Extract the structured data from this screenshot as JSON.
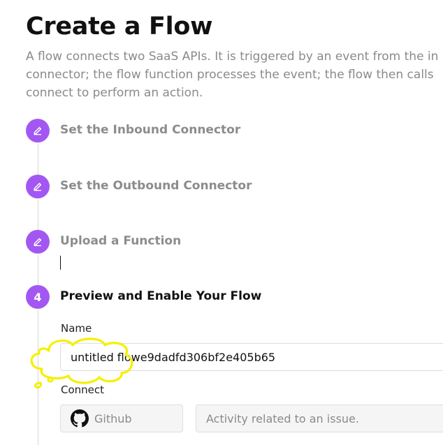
{
  "page": {
    "title": "Create a Flow",
    "description_lines": [
      "A flow connects two SaaS APIs. It is triggered by an event from the in",
      "connector; the flow function processes the event; the flow then calls",
      "connect to perform an action."
    ]
  },
  "steps": [
    {
      "label": "Set the Inbound Connector",
      "icon": "pencil-icon",
      "state": "done"
    },
    {
      "label": "Set the Outbound Connector",
      "icon": "pencil-icon",
      "state": "done"
    },
    {
      "label": "Upload a Function",
      "icon": "pencil-icon",
      "state": "done"
    },
    {
      "label": "Preview and Enable Your Flow",
      "number": "4",
      "state": "active"
    }
  ],
  "form": {
    "name_label": "Name",
    "name_value": "untitled flowe9dadfd306bf2e405b65",
    "connect_label": "Connect",
    "connector_name": "Github",
    "connector_icon": "github-icon",
    "event_placeholder": "Activity related to an issue."
  },
  "colors": {
    "step_purple": "#a357f2",
    "annotation_yellow": "#f5f000",
    "muted_text": "#8a8a8a"
  }
}
